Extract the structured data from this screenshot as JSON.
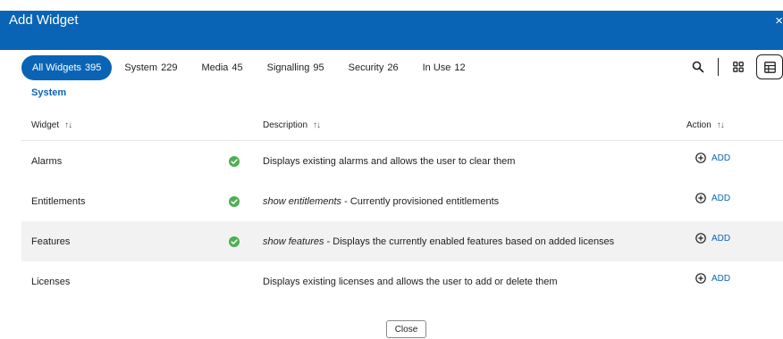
{
  "dialog": {
    "title": "Add Widget",
    "close_glyph": "×"
  },
  "tabs": [
    {
      "label": "All Widgets",
      "count": "395"
    },
    {
      "label": "System",
      "count": "229"
    },
    {
      "label": "Media",
      "count": "45"
    },
    {
      "label": "Signalling",
      "count": "95"
    },
    {
      "label": "Security",
      "count": "26"
    },
    {
      "label": "In Use",
      "count": "12"
    }
  ],
  "tools": {
    "search_icon": "search-icon",
    "grid_icon": "grid-view-icon",
    "table_icon": "table-view-icon"
  },
  "section": {
    "label": "System"
  },
  "table": {
    "headers": {
      "widget": "Widget",
      "description": "Description",
      "action": "Action",
      "sort_glyph": "↑↓"
    },
    "rows": [
      {
        "name": "Alarms",
        "check": true,
        "desc_italic": "",
        "desc": "Displays existing alarms and allows the user to clear them",
        "action": "ADD"
      },
      {
        "name": "Entitlements",
        "check": true,
        "desc_italic": "show entitlements",
        "desc": " - Currently provisioned entitlements",
        "action": "ADD"
      },
      {
        "name": "Features",
        "check": true,
        "desc_italic": "show features",
        "desc": " - Displays the currently enabled features based on added licenses",
        "action": "ADD"
      },
      {
        "name": "Licenses",
        "check": false,
        "desc_italic": "",
        "desc": "Displays existing licenses and allows the user to add or delete them",
        "action": "ADD"
      }
    ]
  },
  "footer": {
    "close_label": "Close"
  },
  "colors": {
    "primary": "#0a64b5",
    "check_green": "#4caf50",
    "row_shade": "#f2f2f2"
  }
}
